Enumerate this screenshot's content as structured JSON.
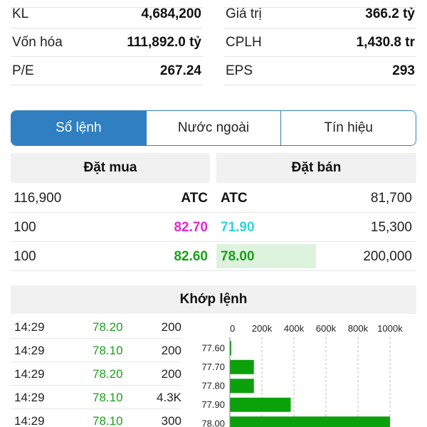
{
  "stats": {
    "rows": [
      {
        "left_label": "KL",
        "left_value": "4,684,200",
        "right_label": "Giá trị",
        "right_value": "366.2 tỷ"
      },
      {
        "left_label": "Vốn hóa",
        "left_value": "111,892.0 tỷ",
        "right_label": "CPLH",
        "right_value": "1,430.8 tr"
      },
      {
        "left_label": "P/E",
        "left_value": "267.24",
        "right_label": "EPS",
        "right_value": "293"
      }
    ]
  },
  "tabs": [
    {
      "label": "Sổ lệnh",
      "active": true
    },
    {
      "label": "Nước ngoài",
      "active": false
    },
    {
      "label": "Tín hiệu",
      "active": false
    }
  ],
  "order_book": {
    "buy_header": "Đặt mua",
    "sell_header": "Đặt bán",
    "rows": [
      {
        "buy_volume": "116,900",
        "buy_price": "ATC",
        "buy_color": "black",
        "sell_price": "ATC",
        "sell_color": "black",
        "sell_volume": "81,700",
        "sell_depth": 0
      },
      {
        "buy_volume": "100",
        "buy_price": "82.70",
        "buy_color": "magenta",
        "sell_price": "71.90",
        "sell_color": "cyan",
        "sell_volume": "15,300",
        "sell_depth": 0
      },
      {
        "buy_volume": "100",
        "buy_price": "82.60",
        "buy_color": "green",
        "sell_price": "78.00",
        "sell_color": "green",
        "sell_volume": "200,000",
        "sell_depth": 1
      }
    ]
  },
  "matched": {
    "header": "Khớp lệnh",
    "trades": [
      {
        "time": "14:29",
        "price": "78.20",
        "volume": "200"
      },
      {
        "time": "14:29",
        "price": "78.10",
        "volume": "200"
      },
      {
        "time": "14:29",
        "price": "78.20",
        "volume": "200"
      },
      {
        "time": "14:29",
        "price": "78.10",
        "volume": "4.3K"
      },
      {
        "time": "14:29",
        "price": "78.10",
        "volume": "300"
      }
    ]
  },
  "chart_data": {
    "type": "bar",
    "orientation": "horizontal",
    "categories": [
      "77.60",
      "77.70",
      "77.80",
      "77.90",
      "78.00"
    ],
    "values": [
      5000,
      150000,
      150000,
      380000,
      1000000
    ],
    "xlim": [
      0,
      1000000
    ],
    "xticks": [
      "0",
      "200k",
      "400k",
      "600k",
      "800k",
      "1000k"
    ],
    "bar_color": "#0aa10a",
    "grid": true
  }
}
